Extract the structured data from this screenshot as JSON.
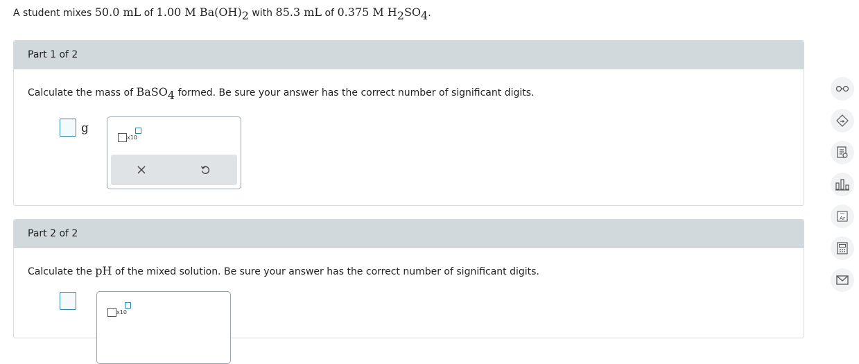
{
  "problem": {
    "text_a": "A student mixes ",
    "vol1": "50.0 mL",
    "text_of1": " of ",
    "conc1": "1.00 M Ba",
    "oh": "(OH)",
    "oh_sub": "2",
    "text_with": " with ",
    "vol2": "85.3 mL",
    "text_of2": " of ",
    "conc2": "0.375 M H",
    "h_sub": "2",
    "so": "SO",
    "so_sub": "4",
    "period": "."
  },
  "part1": {
    "header": "Part 1 of 2",
    "prompt_pre": "Calculate the mass of ",
    "formula": "BaSO",
    "formula_sub": "4",
    "prompt_post": " formed. Be sure your answer has the correct number of significant digits.",
    "answer_value": "",
    "unit": "g",
    "keypad": {
      "sci_label": "x10"
    }
  },
  "part2": {
    "header": "Part 2 of 2",
    "prompt_pre": "Calculate the ",
    "formula": "pH",
    "prompt_post": " of the mixed solution. Be sure your answer has the correct number of significant digits.",
    "answer_value": "",
    "keypad": {
      "sci_label": "x10"
    }
  },
  "toolbar": {
    "icons": [
      "glasses-icon",
      "eraser-icon",
      "checklist-icon",
      "bar-chart-icon",
      "periodic-table-icon",
      "calculator-icon",
      "mail-icon"
    ],
    "periodic_symbol": "Ar"
  },
  "colors": {
    "header_bg": "#d2d9dd",
    "accent": "#2c86a8",
    "actions_bg": "#dfe3e6"
  }
}
